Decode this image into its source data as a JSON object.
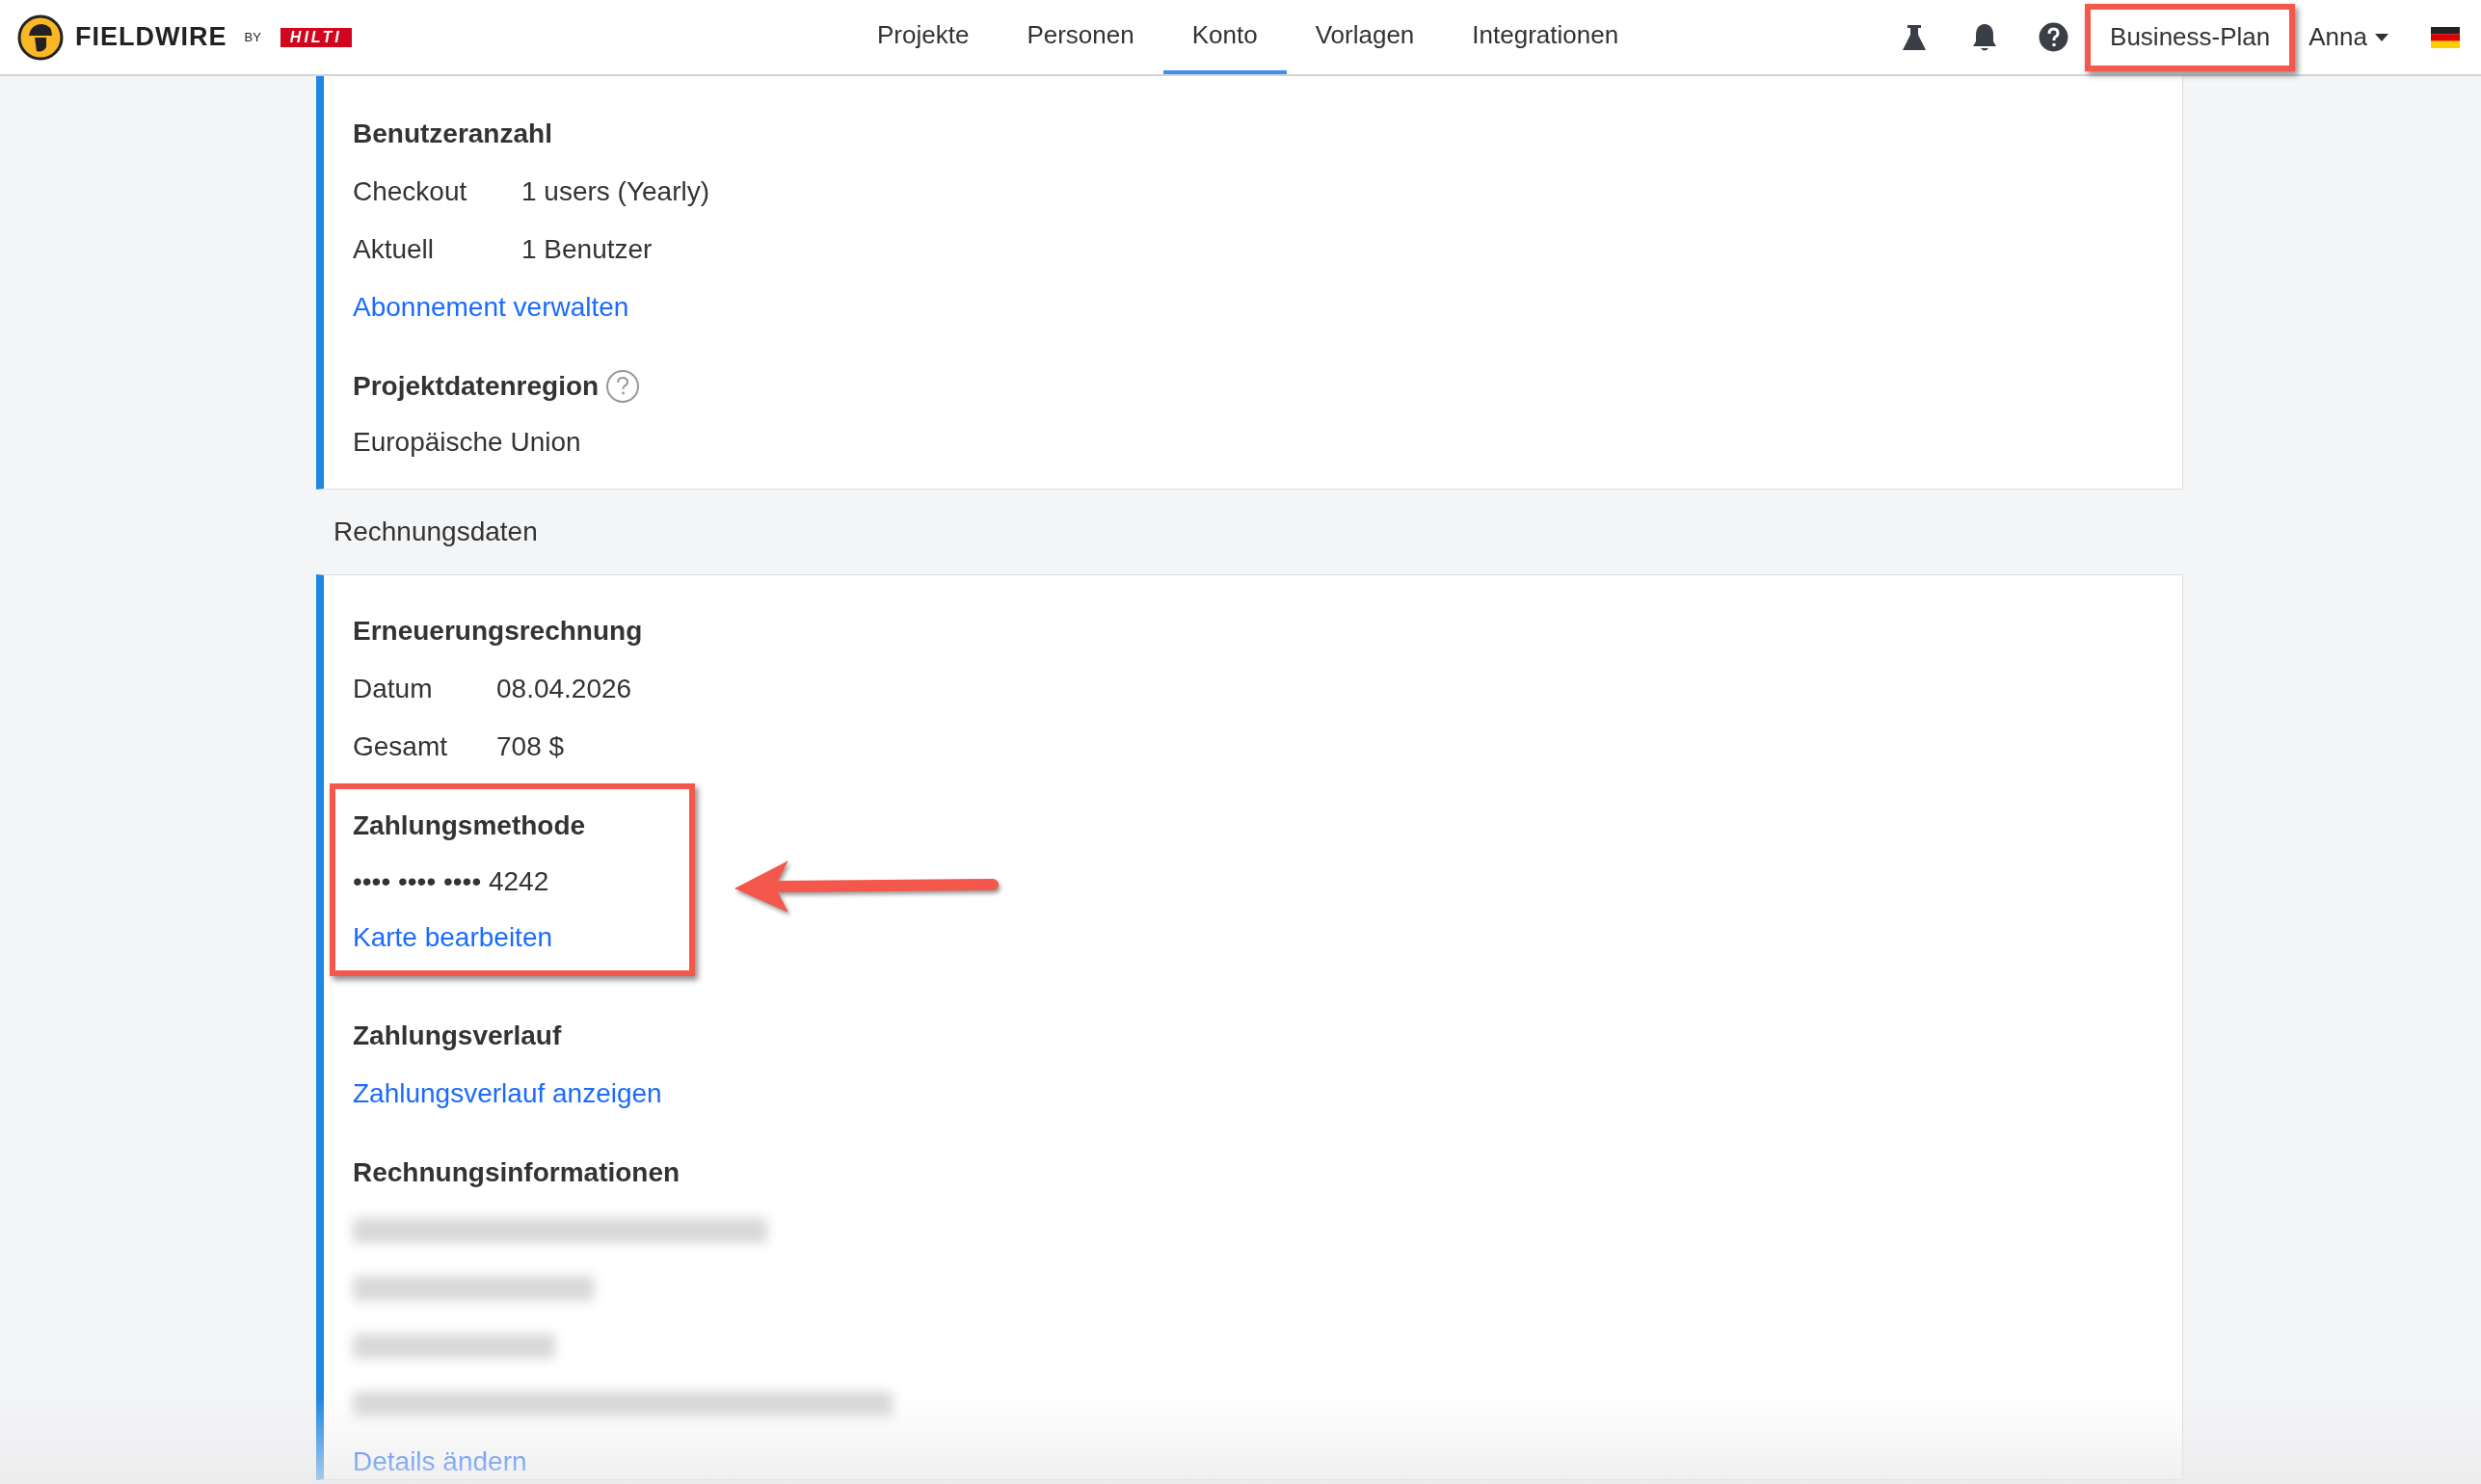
{
  "header": {
    "brand": "FIELDWIRE",
    "brand_by": "BY",
    "partner": "HILTI",
    "nav": [
      {
        "label": "Projekte",
        "selected": false
      },
      {
        "label": "Personen",
        "selected": false
      },
      {
        "label": "Konto",
        "selected": true
      },
      {
        "label": "Vorlagen",
        "selected": false
      },
      {
        "label": "Integrationen",
        "selected": false
      }
    ],
    "plan_button": {
      "label": "Business-Plan",
      "highlighted": true
    },
    "user": "Anna"
  },
  "subscription_card": {
    "sections": [
      {
        "title": "Benutzeranzahl",
        "rows": [
          {
            "label": "Checkout",
            "value": "1 users (Yearly)"
          },
          {
            "label": "Aktuell",
            "value": "1 Benutzer"
          }
        ],
        "link": "Abonnement verwalten"
      },
      {
        "title": "Projektdatenregion",
        "help": true,
        "text": "Europäische Union"
      }
    ]
  },
  "billing_heading": "Rechnungsdaten",
  "billing_card": {
    "sections": [
      {
        "title": "Erneuerungsrechnung",
        "rows": [
          {
            "label": "Datum",
            "value": "08.04.2026"
          },
          {
            "label": "Gesamt",
            "value": "708 $"
          }
        ]
      },
      {
        "title": "Zahlungsmethode",
        "text": "•••• •••• •••• 4242",
        "link": "Karte bearbeiten",
        "highlighted": true,
        "arrow": true
      },
      {
        "title": "Zahlungsverlauf",
        "link": "Zahlungsverlauf anzeigen"
      },
      {
        "title": "Rechnungsinformationen",
        "redacted_lines": [
          {
            "kind": "blurred"
          },
          {
            "kind": "blurred"
          },
          {
            "kind": "blurred"
          },
          {
            "kind": "blurred"
          }
        ],
        "link": "Details ändern"
      }
    ]
  }
}
